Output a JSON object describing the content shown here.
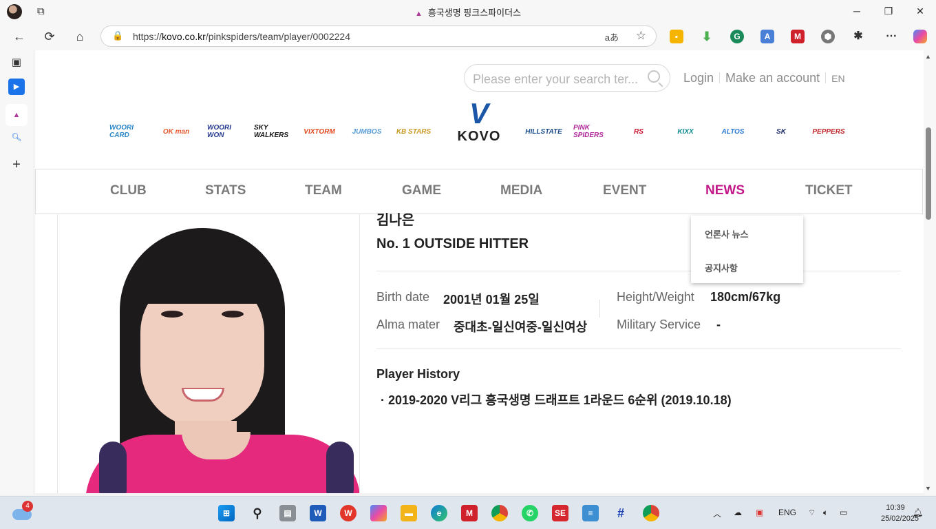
{
  "browser": {
    "tab_title": "흥국생명 핑크스파이더스",
    "url_prefix": "https://",
    "url_domain": "kovo.co.kr",
    "url_path": "/pinkspiders/team/player/0002224",
    "read_aloud": "aあ"
  },
  "header": {
    "search_placeholder": "Please enter your search ter...",
    "login": "Login",
    "signup": "Make an account",
    "lang": "EN"
  },
  "team_logos": [
    {
      "name": "WOORI CARD",
      "color": "#2a86c5"
    },
    {
      "name": "OK man",
      "color": "#e3572c"
    },
    {
      "name": "WOORI WON",
      "color": "#253a8e"
    },
    {
      "name": "SKY WALKERS",
      "color": "#111111"
    },
    {
      "name": "VIXTORM",
      "color": "#e14a1f"
    },
    {
      "name": "JUMBOS",
      "color": "#5a9bd5"
    },
    {
      "name": "KB STARS",
      "color": "#c89a25"
    },
    {
      "name": "HILLSTATE",
      "color": "#1c4f8a"
    },
    {
      "name": "PINK SPIDERS",
      "color": "#b0279a"
    },
    {
      "name": "RS",
      "color": "#c8102e"
    },
    {
      "name": "KIXX",
      "color": "#0f8b8d"
    },
    {
      "name": "ALTOS",
      "color": "#2b7bd1"
    },
    {
      "name": "SK",
      "color": "#1d2d6b"
    },
    {
      "name": "PEPPERS",
      "color": "#c0232b"
    }
  ],
  "kovo_logo": {
    "mark": "V",
    "word": "KOVO"
  },
  "gnb": [
    {
      "label": "CLUB",
      "active": false
    },
    {
      "label": "STATS",
      "active": false
    },
    {
      "label": "TEAM",
      "active": false
    },
    {
      "label": "GAME",
      "active": false
    },
    {
      "label": "MEDIA",
      "active": false
    },
    {
      "label": "EVENT",
      "active": false
    },
    {
      "label": "NEWS",
      "active": true
    },
    {
      "label": "TICKET",
      "active": false
    }
  ],
  "news_dropdown": [
    "언론사 뉴스",
    "공지사항"
  ],
  "player": {
    "name_cut": "김나은",
    "number_position": "No. 1 OUTSIDE HITTER",
    "birth_label": "Birth date",
    "birth_value": "2001년 01월 25일",
    "hw_label": "Height/Weight",
    "hw_value": "180cm/67kg",
    "alma_label": "Alma mater",
    "alma_value": "중대초-일신여중-일신여상",
    "military_label": "Military Service",
    "military_value": "-",
    "history_title": "Player History",
    "history": [
      "· 2019-2020 V리그 흥국생명 드래프트 1라운드 6순위 (2019.10.18)"
    ]
  },
  "taskbar": {
    "weather_badge": "4",
    "lang": "ENG",
    "time": "10:39",
    "date": "25/02/2025"
  },
  "colors": {
    "accent": "#c2188a",
    "gnb_text": "#7a7a7a"
  }
}
